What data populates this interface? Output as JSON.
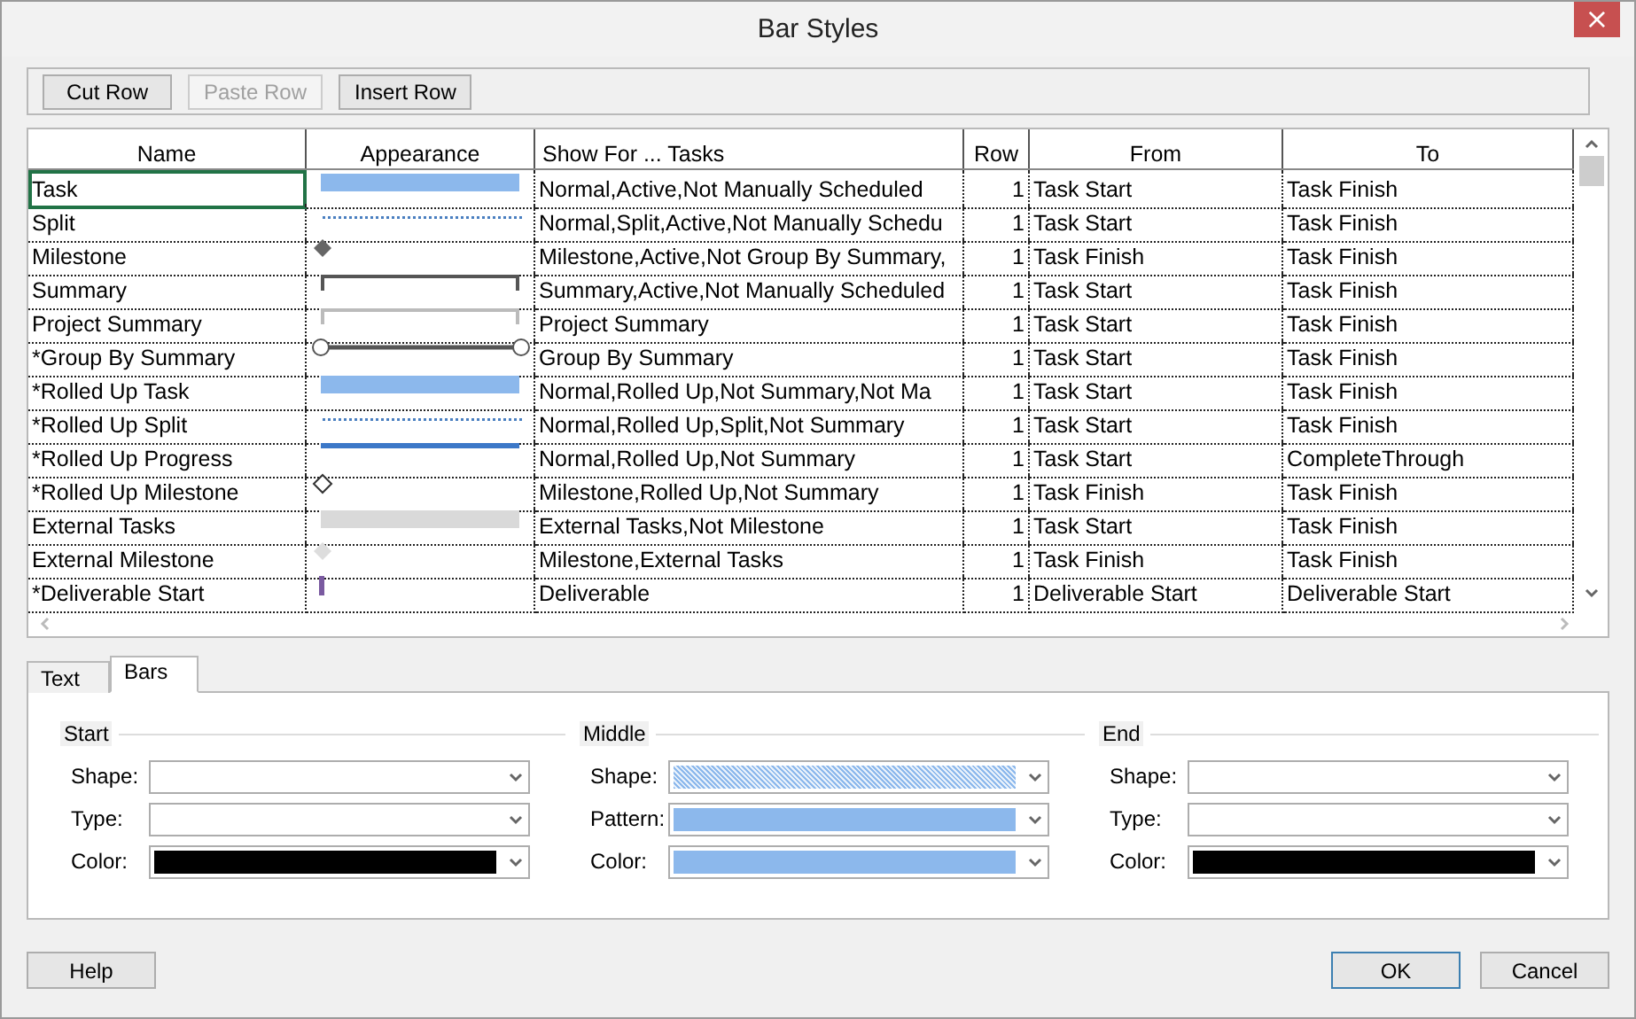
{
  "window": {
    "title": "Bar Styles",
    "close": "×"
  },
  "toolbar": [
    {
      "label": "Cut Row",
      "disabled": false
    },
    {
      "label": "Paste Row",
      "disabled": true
    },
    {
      "label": "Insert Row",
      "disabled": false
    }
  ],
  "table": {
    "columns": [
      "Name",
      "Appearance",
      "Show For ... Tasks",
      "Row",
      "From",
      "To"
    ],
    "rows": [
      {
        "name": "Task",
        "appearance": {
          "kind": "bar",
          "color": "#8cb8ec"
        },
        "show_for": "Normal,Active,Not Manually Scheduled",
        "row": "1",
        "from": "Task Start",
        "to": "Task Finish",
        "selected": true
      },
      {
        "name": "Split",
        "appearance": {
          "kind": "dots",
          "color": "#4a7fc0"
        },
        "show_for": "Normal,Split,Active,Not Manually Schedu",
        "row": "1",
        "from": "Task Start",
        "to": "Task Finish",
        "selected": false
      },
      {
        "name": "Milestone",
        "appearance": {
          "kind": "diamond",
          "color": "#666666"
        },
        "show_for": "Milestone,Active,Not Group By Summary,",
        "row": "1",
        "from": "Task Finish",
        "to": "Task Finish",
        "selected": false
      },
      {
        "name": "Summary",
        "appearance": {
          "kind": "bracket",
          "color": "#555555"
        },
        "show_for": "Summary,Active,Not Manually Scheduled",
        "row": "1",
        "from": "Task Start",
        "to": "Task Finish",
        "selected": false
      },
      {
        "name": "Project Summary",
        "appearance": {
          "kind": "bracket",
          "color": "#bbbbbb"
        },
        "show_for": "Project Summary",
        "row": "1",
        "from": "Task Start",
        "to": "Task Finish",
        "selected": false
      },
      {
        "name": "*Group By Summary",
        "appearance": {
          "kind": "rounded",
          "color": "#555555"
        },
        "show_for": "Group By Summary",
        "row": "1",
        "from": "Task Start",
        "to": "Task Finish",
        "selected": false
      },
      {
        "name": "*Rolled Up Task",
        "appearance": {
          "kind": "bar",
          "color": "#8cb8ec"
        },
        "show_for": "Normal,Rolled Up,Not Summary,Not Ma",
        "row": "1",
        "from": "Task Start",
        "to": "Task Finish",
        "selected": false
      },
      {
        "name": "*Rolled Up Split",
        "appearance": {
          "kind": "dots",
          "color": "#4a7fc0"
        },
        "show_for": "Normal,Rolled Up,Split,Not Summary",
        "row": "1",
        "from": "Task Start",
        "to": "Task Finish",
        "selected": false
      },
      {
        "name": "*Rolled Up Progress",
        "appearance": {
          "kind": "line",
          "color": "#3c78c8"
        },
        "show_for": "Normal,Rolled Up,Not Summary",
        "row": "1",
        "from": "Task Start",
        "to": "CompleteThrough",
        "selected": false
      },
      {
        "name": "*Rolled Up Milestone",
        "appearance": {
          "kind": "hollow",
          "color": "#333333"
        },
        "show_for": "Milestone,Rolled Up,Not Summary",
        "row": "1",
        "from": "Task Finish",
        "to": "Task Finish",
        "selected": false
      },
      {
        "name": "External Tasks",
        "appearance": {
          "kind": "bar",
          "color": "#d9d9d9"
        },
        "show_for": "External Tasks,Not Milestone",
        "row": "1",
        "from": "Task Start",
        "to": "Task Finish",
        "selected": false
      },
      {
        "name": "External Milestone",
        "appearance": {
          "kind": "diamond",
          "color": "#dddddd"
        },
        "show_for": "Milestone,External Tasks",
        "row": "1",
        "from": "Task Finish",
        "to": "Task Finish",
        "selected": false
      },
      {
        "name": "*Deliverable Start",
        "appearance": {
          "kind": "tick",
          "color": "#7a5aa0"
        },
        "show_for": "Deliverable",
        "row": "1",
        "from": "Deliverable Start",
        "to": "Deliverable Start",
        "selected": false
      }
    ]
  },
  "tabs": [
    {
      "label": "Text",
      "selected": false
    },
    {
      "label": "Bars",
      "selected": true
    }
  ],
  "bars": [
    {
      "title": "Start",
      "fields": [
        {
          "label": "Shape:",
          "kind": "empty"
        },
        {
          "label": "Type:",
          "kind": "empty"
        },
        {
          "label": "Color:",
          "kind": "solid",
          "color": "#000000"
        }
      ]
    },
    {
      "title": "Middle",
      "fields": [
        {
          "label": "Shape:",
          "kind": "hatched",
          "color": "#8cb8ec"
        },
        {
          "label": "Pattern:",
          "kind": "solid",
          "color": "#8cb8ec"
        },
        {
          "label": "Color:",
          "kind": "solid",
          "color": "#8cb8ec"
        }
      ]
    },
    {
      "title": "End",
      "fields": [
        {
          "label": "Shape:",
          "kind": "empty"
        },
        {
          "label": "Type:",
          "kind": "empty"
        },
        {
          "label": "Color:",
          "kind": "solid",
          "color": "#000000"
        }
      ]
    }
  ],
  "footer": {
    "help": "Help",
    "ok": "OK",
    "cancel": "Cancel"
  }
}
